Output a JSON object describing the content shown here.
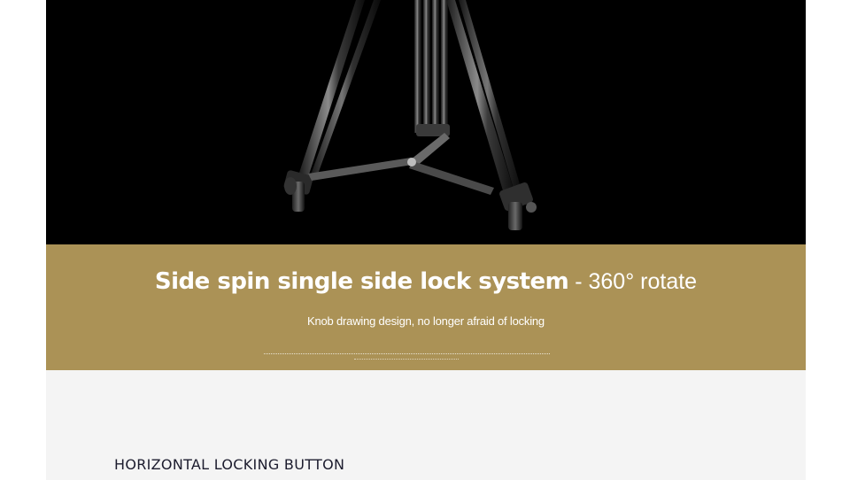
{
  "hero": {
    "image_alt": "tripod legs with spreader"
  },
  "feature": {
    "headline_bold": "Side spin single side lock system",
    "headline_rest": " - 360° rotate",
    "subtitle": "Knob drawing design, no longer afraid of locking",
    "band_color": "#ab9256"
  },
  "section": {
    "title": "HORIZONTAL LOCKING BUTTON"
  }
}
